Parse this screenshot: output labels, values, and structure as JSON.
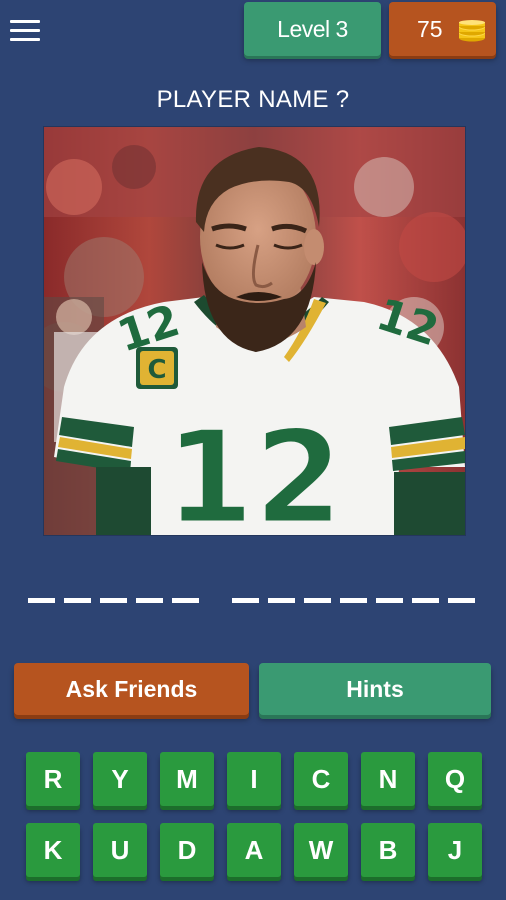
{
  "header": {
    "menu_icon": "hamburger-menu-icon",
    "level_label": "Level 3",
    "coins": "75",
    "coin_icon": "coin-stack-icon"
  },
  "question": "PLAYER NAME ?",
  "photo": {
    "subject": "football player wearing white jersey number 12",
    "jersey_number": "12",
    "patch_letter": "C"
  },
  "answer": {
    "word_lengths": [
      5,
      7
    ]
  },
  "actions": {
    "ask_friends_label": "Ask Friends",
    "hints_label": "Hints"
  },
  "keyboard": {
    "row1": [
      "R",
      "Y",
      "M",
      "I",
      "C",
      "N",
      "Q"
    ],
    "row2": [
      "K",
      "U",
      "D",
      "A",
      "W",
      "B",
      "J"
    ]
  },
  "colors": {
    "background": "#2d4473",
    "green_button": "#3a9a72",
    "orange_button": "#b6541f",
    "key_green": "#2a9a3e"
  }
}
